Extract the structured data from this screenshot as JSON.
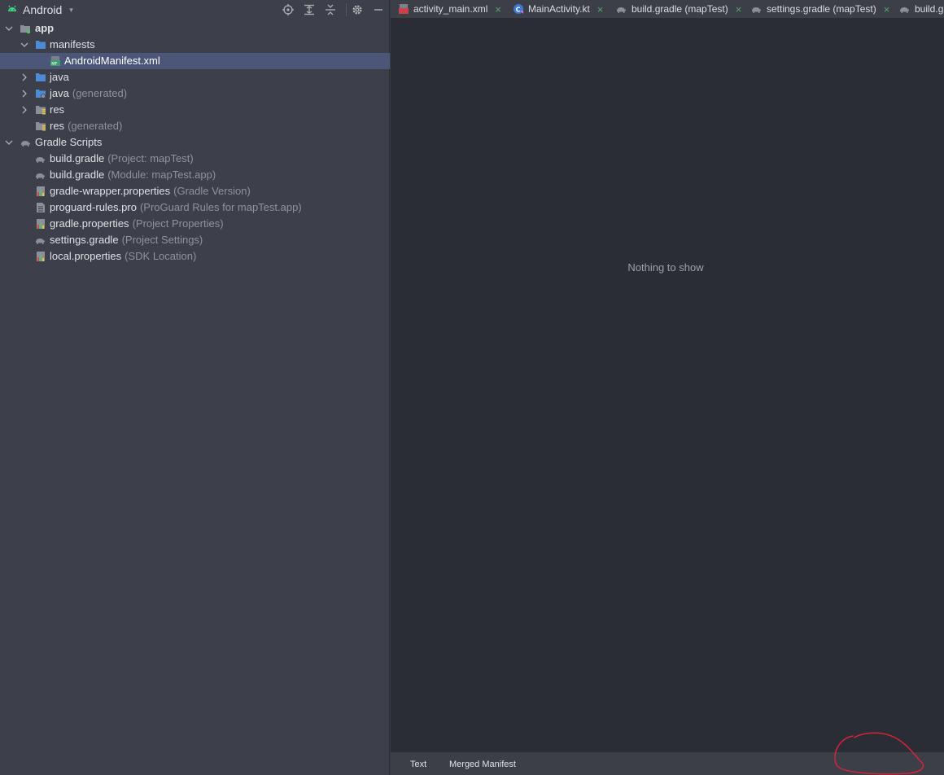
{
  "project_pane": {
    "view_selector": {
      "label": "Android",
      "icon": "android-icon",
      "caret": "▾"
    },
    "toolbar_icons": [
      "locate-icon",
      "expand-all-icon",
      "collapse-all-icon",
      "gear-icon",
      "minimize-icon"
    ]
  },
  "tree": {
    "app": {
      "label": "app"
    },
    "manifests": {
      "label": "manifests"
    },
    "android_manifest": {
      "label": "AndroidManifest.xml"
    },
    "java": {
      "label": "java"
    },
    "java_generated": {
      "label": "java",
      "hint": "(generated)"
    },
    "res": {
      "label": "res"
    },
    "res_generated": {
      "label": "res",
      "hint": "(generated)"
    },
    "gradle_scripts": {
      "label": "Gradle Scripts"
    },
    "build_gradle_project": {
      "label": "build.gradle",
      "hint": "(Project: mapTest)"
    },
    "build_gradle_module": {
      "label": "build.gradle",
      "hint": "(Module: mapTest.app)"
    },
    "gradle_wrapper": {
      "label": "gradle-wrapper.properties",
      "hint": "(Gradle Version)"
    },
    "proguard": {
      "label": "proguard-rules.pro",
      "hint": "(ProGuard Rules for mapTest.app)"
    },
    "gradle_properties": {
      "label": "gradle.properties",
      "hint": "(Project Properties)"
    },
    "settings_gradle": {
      "label": "settings.gradle",
      "hint": "(Project Settings)"
    },
    "local_properties": {
      "label": "local.properties",
      "hint": "(SDK Location)"
    }
  },
  "editor": {
    "tabs": [
      {
        "label": "activity_main.xml",
        "icon": "layout-file-icon",
        "close": "×"
      },
      {
        "label": "MainActivity.kt",
        "icon": "kotlin-class-icon",
        "close": "×"
      },
      {
        "label": "build.gradle (mapTest)",
        "icon": "gradle-elephant-icon",
        "close": "×"
      },
      {
        "label": "settings.gradle (mapTest)",
        "icon": "gradle-elephant-icon",
        "close": "×"
      },
      {
        "label": "build.g",
        "icon": "gradle-elephant-icon"
      }
    ],
    "empty_text": "Nothing to show",
    "bottom_tabs": {
      "text": "Text",
      "merged_manifest": "Merged Manifest"
    }
  },
  "colors": {
    "pane_bg": "#3d3f4b",
    "editor_bg": "#2b2d36",
    "selection": "#4b5679",
    "folder_blue": "#4d8bd6",
    "android_green": "#3ddc84",
    "annotation_red": "#d0243a"
  }
}
